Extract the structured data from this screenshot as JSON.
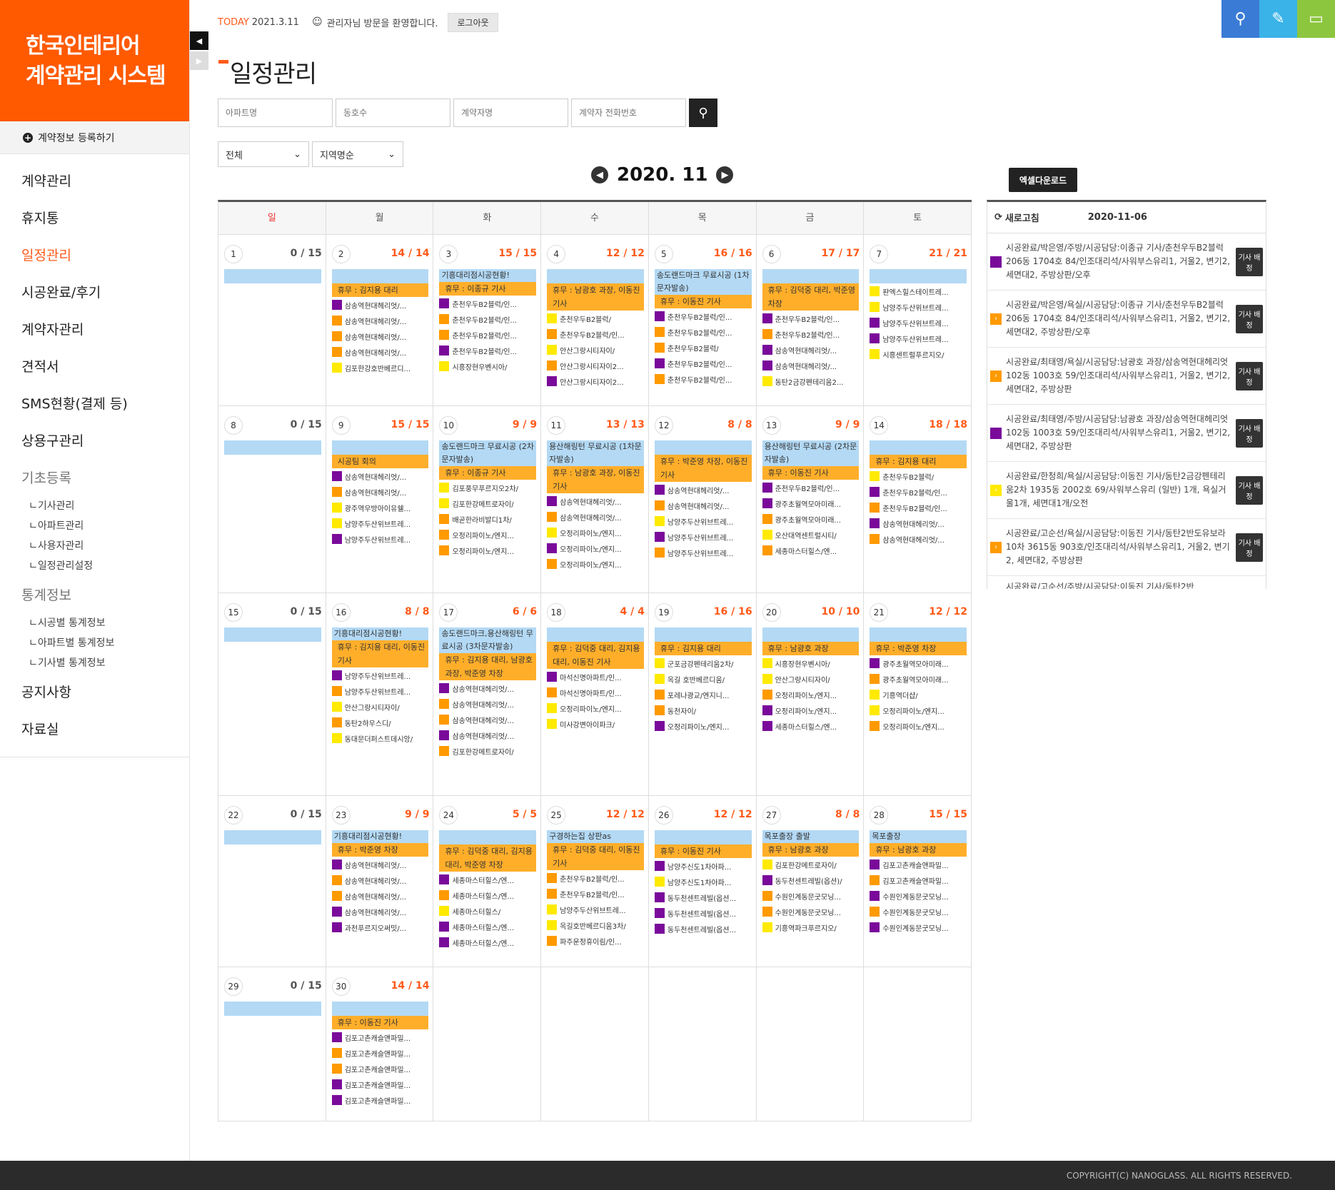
{
  "logo": {
    "line1": "한국인테리어",
    "line2": "계약관리 시스템"
  },
  "register": {
    "label": "계약정보 등록하기"
  },
  "nav": [
    {
      "label": "계약관리",
      "state": "normal"
    },
    {
      "label": "휴지통",
      "state": "normal"
    },
    {
      "label": "일정관리",
      "state": "active"
    },
    {
      "label": "시공완료/후기",
      "state": "normal"
    },
    {
      "label": "계약자관리",
      "state": "normal"
    },
    {
      "label": "견적서",
      "state": "normal"
    },
    {
      "label": "SMS현황(결제 등)",
      "state": "normal"
    },
    {
      "label": "상용구관리",
      "state": "normal"
    }
  ],
  "nav_basic": {
    "label": "기초등록",
    "subs": [
      "ㄴ기사관리",
      "ㄴ아파트관리",
      "ㄴ사용자관리",
      "ㄴ일정관리설정"
    ]
  },
  "nav_stats": {
    "label": "통계정보",
    "subs": [
      "ㄴ시공별 통계정보",
      "ㄴ아파트별 통계정보",
      "ㄴ기사별 통계정보"
    ]
  },
  "nav_tail": [
    "공지사항",
    "자료실"
  ],
  "topbar": {
    "today_label": "TODAY",
    "today_date": "2021.3.11",
    "welcome": "관리자님 방문을 환영합니다.",
    "logout": "로그아웃"
  },
  "colors": {
    "brand": "#ff5a00",
    "search": "#3a7bd5",
    "edit": "#3ab3e8",
    "monitor": "#8cc63f"
  },
  "icons": {
    "search": "search-icon",
    "edit": "edit-icon",
    "monitor": "monitor-icon"
  },
  "page_title": "일정관리",
  "search": {
    "apt": "아파트명",
    "dong": "동호수",
    "name": "계약자명",
    "phone": "계약자 전화번호"
  },
  "filters": {
    "all": "전체",
    "region": "지역명순"
  },
  "month": "2020. 11",
  "weekdays": [
    "일",
    "월",
    "화",
    "수",
    "목",
    "금",
    "토"
  ],
  "weeks": [
    [
      {
        "d": "1",
        "c": "0 / 15",
        "blue": "",
        "or": "",
        "ev": []
      },
      {
        "d": "2",
        "c": "14 / 14",
        "blue": "",
        "or": "휴무 : 김지용 대리",
        "ev": [
          [
            "p",
            "삼송역현대헤리엇/..."
          ],
          [
            "o",
            "삼송역현대헤리엇/..."
          ],
          [
            "o",
            "삼송역현대헤리엇/..."
          ],
          [
            "o",
            "삼송역현대헤리엇/..."
          ],
          [
            "y",
            "김포한강호반베르디..."
          ]
        ]
      },
      {
        "d": "3",
        "c": "15 / 15",
        "blue": "기흥대리점시공현황!",
        "or": "휴무 : 이종규 기사",
        "ev": [
          [
            "p",
            "춘천우두B2블럭/인..."
          ],
          [
            "o",
            "춘천우두B2블럭/인..."
          ],
          [
            "o",
            "춘천우두B2블럭/인..."
          ],
          [
            "p",
            "춘천우두B2블럭/인..."
          ],
          [
            "y",
            "시흥장현우벤시아/"
          ]
        ]
      },
      {
        "d": "4",
        "c": "12 / 12",
        "blue": "",
        "or": "휴무 : 남광호 과장, 이동진 기사",
        "ev": [
          [
            "y",
            "춘천우두B2블럭/"
          ],
          [
            "o",
            "춘천우두B2블럭/인..."
          ],
          [
            "y",
            "안산그랑시티자이/"
          ],
          [
            "o",
            "안산그랑시티자이2..."
          ],
          [
            "p",
            "안산그랑시티자이2..."
          ]
        ]
      },
      {
        "d": "5",
        "c": "16 / 16",
        "blue": "송도랜드마크 무료시공 (1차문자발송)",
        "or": "휴무 : 이동진 기사",
        "ev": [
          [
            "p",
            "춘천우두B2블럭/인..."
          ],
          [
            "o",
            "춘천우두B2블럭/인..."
          ],
          [
            "o",
            "춘천우두B2블럭/"
          ],
          [
            "p",
            "춘천우두B2블럭/인..."
          ],
          [
            "o",
            "춘천우두B2블럭/인..."
          ]
        ]
      },
      {
        "d": "6",
        "c": "17 / 17",
        "blue": "",
        "or": "휴무 : 김덕중 대리, 박준영 차장",
        "ev": [
          [
            "p",
            "춘천우두B2블럭/인..."
          ],
          [
            "o",
            "춘천우두B2블럭/인..."
          ],
          [
            "p",
            "삼송역현대헤리엇/..."
          ],
          [
            "p",
            "삼송역현대헤리엇/..."
          ],
          [
            "y",
            "동탄2금강펜테리움2..."
          ]
        ]
      },
      {
        "d": "7",
        "c": "21 / 21",
        "blue": "",
        "or": "",
        "ev": [
          [
            "y",
            "판엑스힐스테이트레..."
          ],
          [
            "y",
            "남양주두산위브트레..."
          ],
          [
            "p",
            "남양주두산위브트레..."
          ],
          [
            "p",
            "남양주두산위브트레..."
          ],
          [
            "y",
            "시흥센트럴푸르지오/"
          ]
        ]
      }
    ],
    [
      {
        "d": "8",
        "c": "0 / 15",
        "blue": "",
        "or": "",
        "ev": []
      },
      {
        "d": "9",
        "c": "15 / 15",
        "blue": "",
        "or": "시공팀 회의",
        "ev": [
          [
            "p",
            "삼송역현대헤리엇/..."
          ],
          [
            "o",
            "삼송역현대헤리엇/..."
          ],
          [
            "y",
            "광주역우방아이유쉘..."
          ],
          [
            "y",
            "남양주두산위브트레..."
          ],
          [
            "p",
            "남양주두산위브트레..."
          ]
        ]
      },
      {
        "d": "10",
        "c": "9 / 9",
        "blue": "송도랜드마크 무료시공 (2차문자발송)",
        "or": "휴무 : 이종규 기사",
        "ev": [
          [
            "y",
            "김포풍무푸르지오2차/"
          ],
          [
            "y",
            "김포한강메트로자이/"
          ],
          [
            "o",
            "배곧한라비발디1차/"
          ],
          [
            "o",
            "오정리파이노/엔지..."
          ],
          [
            "o",
            "오정리파이노/엔지..."
          ]
        ]
      },
      {
        "d": "11",
        "c": "13 / 13",
        "blue": "용산해링턴 무료시공 (1차문자발송)",
        "or": "휴무 : 남광호 과장, 이동진 기사",
        "ev": [
          [
            "p",
            "삼송역현대헤리엇/..."
          ],
          [
            "o",
            "삼송역현대헤리엇/..."
          ],
          [
            "y",
            "오정리파이노/엔지..."
          ],
          [
            "p",
            "오정리파이노/엔지..."
          ],
          [
            "o",
            "오정리파이노/엔지..."
          ]
        ]
      },
      {
        "d": "12",
        "c": "8 / 8",
        "blue": "",
        "or": "휴무 : 박준영 차장, 이동진 기사",
        "ev": [
          [
            "p",
            "삼송역현대헤리엇/..."
          ],
          [
            "o",
            "삼송역현대헤리엇/..."
          ],
          [
            "y",
            "남양주두산위브트레..."
          ],
          [
            "p",
            "남양주두산위브트레..."
          ],
          [
            "o",
            "남양주두산위브트레..."
          ]
        ]
      },
      {
        "d": "13",
        "c": "9 / 9",
        "blue": "용산해링턴 무료시공 (2차문자발송)",
        "or": "휴무 : 이동진 기사",
        "ev": [
          [
            "p",
            "춘천우두B2블럭/인..."
          ],
          [
            "p",
            "광주초월역모아미래..."
          ],
          [
            "o",
            "광주초월역모아미래..."
          ],
          [
            "y",
            "오산대역센트럴시티/"
          ],
          [
            "o",
            "세종마스터힐스/엔..."
          ]
        ]
      },
      {
        "d": "14",
        "c": "18 / 18",
        "blue": "",
        "or": "휴무 : 김지용 대리",
        "ev": [
          [
            "y",
            "춘천우두B2블럭/"
          ],
          [
            "p",
            "춘천우두B2블럭/인..."
          ],
          [
            "o",
            "춘천우두B2블럭/인..."
          ],
          [
            "p",
            "삼송역현대헤리엇/..."
          ],
          [
            "o",
            "삼송역현대헤리엇/..."
          ]
        ]
      }
    ],
    [
      {
        "d": "15",
        "c": "0 / 15",
        "blue": "",
        "or": "",
        "ev": []
      },
      {
        "d": "16",
        "c": "8 / 8",
        "blue": "기흥대리점시공현황!",
        "or": "휴무 : 김지용 대리, 이동진 기사",
        "ev": [
          [
            "p",
            "남양주두산위브트레..."
          ],
          [
            "o",
            "남양주두산위브트레..."
          ],
          [
            "y",
            "안산그랑시티자이/"
          ],
          [
            "o",
            "동탄2하우스디/"
          ],
          [
            "y",
            "동대문더퍼스트데시앙/"
          ]
        ]
      },
      {
        "d": "17",
        "c": "6 / 6",
        "blue": "송도랜드마크,용산해링턴 무료시공 (3차문자발송)",
        "or": "휴무 : 김지용 대리, 남광호 과장, 박준영 차장",
        "ev": [
          [
            "p",
            "삼송역현대헤리엇/..."
          ],
          [
            "o",
            "삼송역현대헤리엇/..."
          ],
          [
            "o",
            "삼송역현대헤리엇/..."
          ],
          [
            "p",
            "삼송역현대헤리엇/..."
          ],
          [
            "o",
            "김포한강메트로자이/"
          ]
        ]
      },
      {
        "d": "18",
        "c": "4 / 4",
        "blue": "",
        "or": "휴무 : 김덕중 대리, 김지용 대리, 이동진 기사",
        "ev": [
          [
            "p",
            "마석신명아파트/인..."
          ],
          [
            "o",
            "마석신명아파트/인..."
          ],
          [
            "y",
            "오정리파이노/엔지..."
          ],
          [
            "y",
            "미사강변아이파크/"
          ]
        ]
      },
      {
        "d": "19",
        "c": "16 / 16",
        "blue": "",
        "or": "휴무 : 김지용 대리",
        "ev": [
          [
            "y",
            "군포금강펜테리움2차/"
          ],
          [
            "y",
            "옥길 호반베르디움/"
          ],
          [
            "o",
            "포레나광교/엔지니..."
          ],
          [
            "o",
            "동천자이/"
          ],
          [
            "p",
            "오정리파이노/엔지..."
          ]
        ]
      },
      {
        "d": "20",
        "c": "10 / 10",
        "blue": "",
        "or": "휴무 : 남광호 과장",
        "ev": [
          [
            "y",
            "시흥장현우벤시아/"
          ],
          [
            "y",
            "안산그랑시티자이/"
          ],
          [
            "o",
            "오정리파이노/엔지..."
          ],
          [
            "p",
            "오정리파이노/엔지..."
          ],
          [
            "p",
            "세종마스터힐스/엔..."
          ]
        ]
      },
      {
        "d": "21",
        "c": "12 / 12",
        "blue": "",
        "or": "휴무 : 박준영 차장",
        "ev": [
          [
            "p",
            "광주초월역모아미래..."
          ],
          [
            "o",
            "광주초월역모아미래..."
          ],
          [
            "y",
            "기흥역더샵/"
          ],
          [
            "y",
            "오정리파이노/엔지..."
          ],
          [
            "o",
            "오정리파이노/엔지..."
          ]
        ]
      }
    ],
    [
      {
        "d": "22",
        "c": "0 / 15",
        "blue": "",
        "or": "",
        "ev": []
      },
      {
        "d": "23",
        "c": "9 / 9",
        "blue": "기흥대리점시공현황!",
        "or": "휴무 : 박준영 차장",
        "ev": [
          [
            "p",
            "삼송역현대헤리엇/..."
          ],
          [
            "o",
            "삼송역현대헤리엇/..."
          ],
          [
            "o",
            "삼송역현대헤리엇/..."
          ],
          [
            "p",
            "삼송역현대헤리엇/..."
          ],
          [
            "p",
            "과천푸르지오써밋/..."
          ]
        ]
      },
      {
        "d": "24",
        "c": "5 / 5",
        "blue": "",
        "or": "휴무 : 김덕중 대리, 김지용 대리, 박준영 차장",
        "ev": [
          [
            "p",
            "세종마스터힐스/엔..."
          ],
          [
            "o",
            "세종마스터힐스/엔..."
          ],
          [
            "y",
            "세종마스터힐스/"
          ],
          [
            "p",
            "세종마스터힐스/엔..."
          ],
          [
            "p",
            "세종마스터힐스/엔..."
          ]
        ]
      },
      {
        "d": "25",
        "c": "12 / 12",
        "blue": "구경하는집 상판as",
        "or": "휴무 : 김덕중 대리, 이동진 기사",
        "ev": [
          [
            "o",
            "춘천우두B2블럭/인..."
          ],
          [
            "o",
            "춘천우두B2블럭/인..."
          ],
          [
            "y",
            "남양주두산위브트레..."
          ],
          [
            "y",
            "옥길호반베르디움3차/"
          ],
          [
            "o",
            "파주운정휴이림/인..."
          ]
        ]
      },
      {
        "d": "26",
        "c": "12 / 12",
        "blue": "",
        "or": "휴무 : 이동진 기사",
        "ev": [
          [
            "p",
            "남양주신도1차아파..."
          ],
          [
            "y",
            "남양주신도1차아파..."
          ],
          [
            "p",
            "동두천센트레빌(옵션..."
          ],
          [
            "p",
            "동두천센트레빌(옵션..."
          ],
          [
            "p",
            "동두천센트레빌(옵션..."
          ]
        ]
      },
      {
        "d": "27",
        "c": "8 / 8",
        "blue": "목포출장 출발",
        "or": "휴무 : 남광호 과장",
        "ev": [
          [
            "y",
            "김포한강메트로자이/"
          ],
          [
            "p",
            "동두천센트레빌(옵션)/"
          ],
          [
            "o",
            "수원인계동문굿모닝..."
          ],
          [
            "o",
            "수원인계동문굿모닝..."
          ],
          [
            "y",
            "기흥역파크푸르지오/"
          ]
        ]
      },
      {
        "d": "28",
        "c": "15 / 15",
        "blue": "목포출장",
        "or": "휴무 : 남광호 과장",
        "ev": [
          [
            "p",
            "김포고촌캐슬앤파밀..."
          ],
          [
            "o",
            "김포고촌캐슬앤파밀..."
          ],
          [
            "p",
            "수원인계동문굿모닝..."
          ],
          [
            "o",
            "수원인계동문굿모닝..."
          ],
          [
            "p",
            "수원인계동문굿모닝..."
          ]
        ]
      }
    ],
    [
      {
        "d": "29",
        "c": "0 / 15",
        "blue": "",
        "or": "",
        "ev": []
      },
      {
        "d": "30",
        "c": "14 / 14",
        "blue": "",
        "or": "휴무 : 이동진 기사",
        "ev": [
          [
            "p",
            "김포고촌캐슬앤파밀..."
          ],
          [
            "o",
            "김포고촌캐슬앤파밀..."
          ],
          [
            "o",
            "김포고촌캐슬앤파밀..."
          ],
          [
            "p",
            "김포고촌캐슬앤파밀..."
          ],
          [
            "p",
            "김포고촌캐슬앤파밀..."
          ]
        ]
      },
      {
        "d": "",
        "c": "",
        "blue": "",
        "or": "",
        "ev": []
      },
      {
        "d": "",
        "c": "",
        "blue": "",
        "or": "",
        "ev": []
      },
      {
        "d": "",
        "c": "",
        "blue": "",
        "or": "",
        "ev": []
      },
      {
        "d": "",
        "c": "",
        "blue": "",
        "or": "",
        "ev": []
      },
      {
        "d": "",
        "c": "",
        "blue": "",
        "or": "",
        "ev": []
      }
    ]
  ],
  "excel": "엑셀다운로드",
  "side": {
    "refresh": "새로고침",
    "date": "2020-11-06",
    "report_label": "기사 배정",
    "items": [
      {
        "mk": "p",
        "text": "시공완료/박은영/주방/시공담당:이종규 기사/춘천우두B2블럭 206동 1704호 84/인조대리석/사워부스유리1, 거울2, 변기2, 세면대2, 주방상판/오후"
      },
      {
        "mk": "o",
        "text": "시공완료/박은영/욕실/시공담당:이종규 기사/춘천우두B2블럭 206동 1704호 84/인조대리석/사워부스유리1, 거울2, 변기2, 세면대2, 주방상판/오후"
      },
      {
        "mk": "o",
        "text": "시공완료/최태영/욕실/시공담당:남광호 과장/삼송역현대헤리엇 102동 1003호 59/인조대리석/사워부스유리1, 거울2, 변기2, 세면대2, 주방상판"
      },
      {
        "mk": "p",
        "text": "시공완료/최태영/주방/시공담당:남광호 과장/삼송역현대헤리엇 102동 1003호 59/인조대리석/사워부스유리1, 거울2, 변기2, 세면대2, 주방상판"
      },
      {
        "mk": "y",
        "text": "시공완료/한청희/욕실/시공담당:이동진 기사/동탄2금강펜테리움2차 1935동 2002호 69/사워부스유리 (일반) 1개, 욕실거울1개, 세면대1개/오전"
      },
      {
        "mk": "o",
        "text": "시공완료/고순선/욕실/시공담당:이동진 기사/동탄2반도유보라10차 3615동 903호/인조대리석/사워부스유리1, 거울2, 변기2, 세면대2, 주방상판"
      },
      {
        "mk": "",
        "text": "시공완료/고순선/주방/시공담당:이동진 기사/동탄2반"
      }
    ]
  },
  "footer": "COPYRIGHT(C) NANOGLASS. ALL RIGHTS RESERVED."
}
